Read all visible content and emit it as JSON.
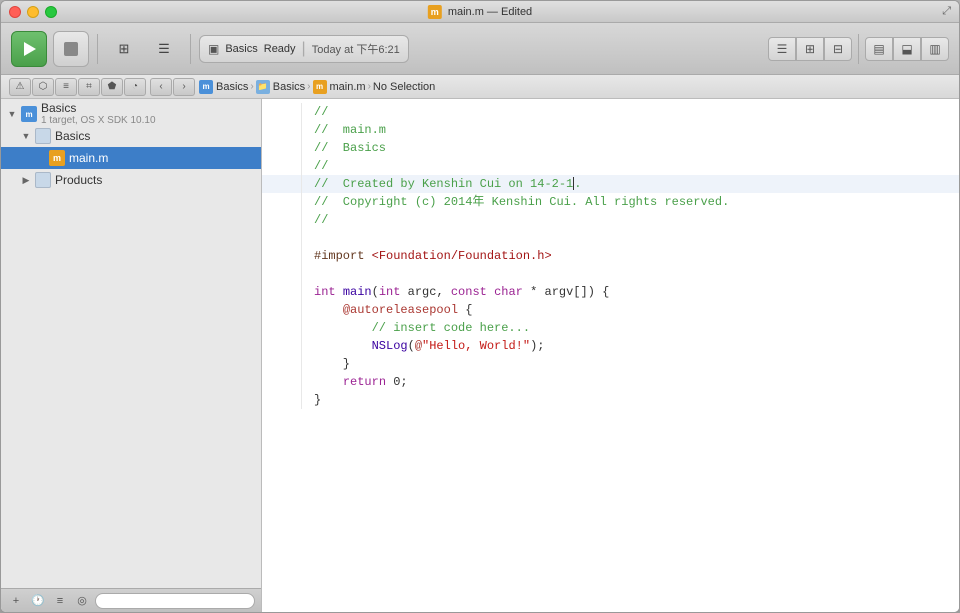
{
  "window": {
    "title": "main.m — Edited",
    "title_icon": "m"
  },
  "titlebar": {
    "filename": "main.m — Edited"
  },
  "toolbar": {
    "scheme_label": "Basics",
    "status": "Ready",
    "divider": "|",
    "timestamp": "Today at 下午6:21"
  },
  "breadcrumb": {
    "items": [
      "Basics",
      "Basics",
      "main.m",
      "No Selection"
    ]
  },
  "sidebar": {
    "tree": [
      {
        "id": "basics-project",
        "label": "Basics",
        "sublabel": "1 target, OS X SDK 10.10",
        "level": 0,
        "type": "project",
        "disclosure": "open"
      },
      {
        "id": "basics-group",
        "label": "Basics",
        "level": 1,
        "type": "group",
        "disclosure": "open"
      },
      {
        "id": "main-m",
        "label": "main.m",
        "level": 2,
        "type": "objc",
        "disclosure": "leaf",
        "selected": true
      },
      {
        "id": "products-group",
        "label": "Products",
        "level": 1,
        "type": "group",
        "disclosure": "closed"
      }
    ],
    "bottom": {
      "add_label": "+",
      "filter_placeholder": ""
    }
  },
  "editor": {
    "lines": [
      {
        "num": "",
        "content": "//",
        "type": "comment"
      },
      {
        "num": "",
        "content": "//  main.m",
        "type": "comment"
      },
      {
        "num": "",
        "content": "//  Basics",
        "type": "comment"
      },
      {
        "num": "",
        "content": "//",
        "type": "comment"
      },
      {
        "num": "",
        "content": "//  Created by Kenshin Cui on 14-2-1.",
        "type": "comment",
        "cursor": true
      },
      {
        "num": "",
        "content": "//  Copyright (c) 2014年 Kenshin Cui. All rights reserved.",
        "type": "comment"
      },
      {
        "num": "",
        "content": "//",
        "type": "comment"
      },
      {
        "num": "",
        "content": "",
        "type": "blank"
      },
      {
        "num": "",
        "content": "#import <Foundation/Foundation.h>",
        "type": "preprocessor"
      },
      {
        "num": "",
        "content": "",
        "type": "blank"
      },
      {
        "num": "",
        "content": "int main(int argc, const char * argv[]) {",
        "type": "code"
      },
      {
        "num": "",
        "content": "    @autoreleasepool {",
        "type": "code_indent1"
      },
      {
        "num": "",
        "content": "        // insert code here...",
        "type": "comment_indent"
      },
      {
        "num": "",
        "content": "        NSLog(@\"Hello, World!\");",
        "type": "code_indent2"
      },
      {
        "num": "",
        "content": "    }",
        "type": "code_indent1"
      },
      {
        "num": "",
        "content": "    return 0;",
        "type": "code_indent1_return"
      },
      {
        "num": "",
        "content": "}",
        "type": "code"
      }
    ]
  }
}
